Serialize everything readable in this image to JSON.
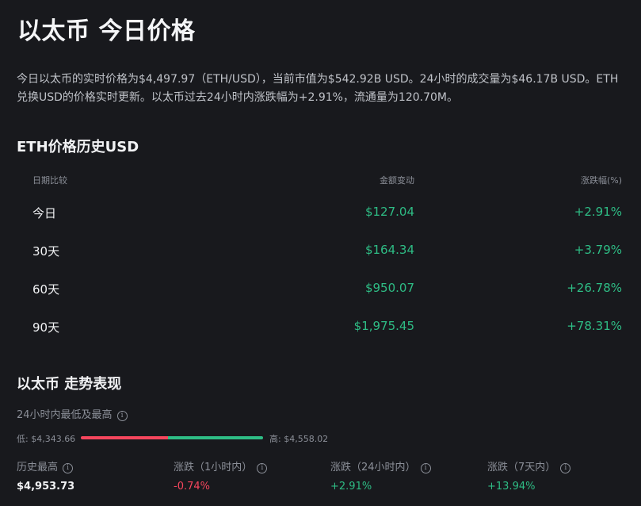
{
  "page": {
    "title": "以太币 今日价格",
    "intro": "今日以太币的实时价格为$4,497.97（ETH/USD），当前市值为$542.92B USD。24小时的成交量为$46.17B USD。ETH兑换USD的价格实时更新。以太币过去24小时内涨跌幅为+2.91%，流通量为120.70M。"
  },
  "history": {
    "title": "ETH价格历史USD",
    "headers": {
      "period": "日期比较",
      "amount": "金额变动",
      "pct": "涨跌幅(%)"
    },
    "rows": [
      {
        "period": "今日",
        "amount": "$127.04",
        "pct": "+2.91%"
      },
      {
        "period": "30天",
        "amount": "$164.34",
        "pct": "+3.79%"
      },
      {
        "period": "60天",
        "amount": "$950.07",
        "pct": "+26.78%"
      },
      {
        "period": "90天",
        "amount": "$1,975.45",
        "pct": "+78.31%"
      }
    ]
  },
  "performance": {
    "title": "以太币 走势表现",
    "range_label": "24小时内最低及最高",
    "info_glyph": "i",
    "low_label": "低: $4,343.66",
    "high_label": "高: $4,558.02",
    "range_fill_fraction": 0.48,
    "colors": {
      "up": "#2ebd85",
      "down": "#f6465d"
    },
    "stats": [
      {
        "label": "历史最高",
        "value": "$4,953.73",
        "tone": "white"
      },
      {
        "label": "涨跌（1小时内）",
        "value": "-0.74%",
        "tone": "down"
      },
      {
        "label": "涨跌（24小时内）",
        "value": "+2.91%",
        "tone": "up"
      },
      {
        "label": "涨跌（7天内）",
        "value": "+13.94%",
        "tone": "up"
      }
    ]
  }
}
